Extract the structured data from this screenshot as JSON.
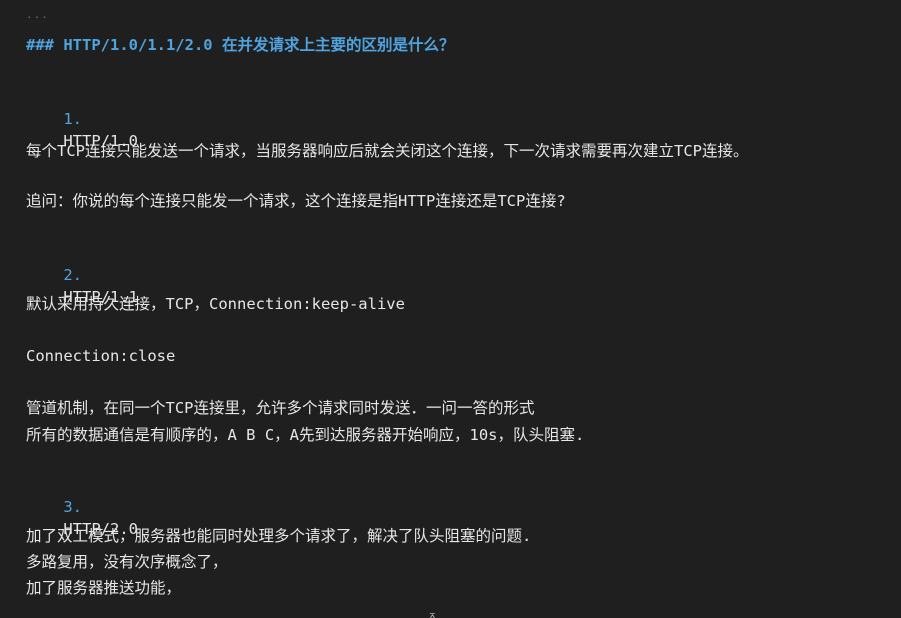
{
  "editor": {
    "fold_marker": "...",
    "heading": "### HTTP/1.0/1.1/2.0 在并发请求上主要的区别是什么？",
    "sections": [
      {
        "number": "1.",
        "title": "HTTP/1.0"
      },
      {
        "number": "2.",
        "title": "HTTP/1.1"
      },
      {
        "number": "3.",
        "title": "HTTP/2.0"
      }
    ],
    "paragraphs": {
      "p1": "每个TCP连接只能发送一个请求，当服务器响应后就会关闭这个连接，下一次请求需要再次建立TCP连接。",
      "p2": "追问：你说的每个连接只能发一个请求，这个连接是指HTTP连接还是TCP连接?",
      "p3": "默认采用持久连接，TCP，Connection:keep-alive",
      "p4": "Connection:close",
      "p5a": "管道机制，在同一个TCP连接里，允许多个请求同时发送．一问一答的形式",
      "p5b": "所有的数据通信是有顺序的，A B C，A先到达服务器开始响应，10s，队头阻塞.",
      "p6a": "加了双工模式，服务器也能同时处理多个请求了，解决了队头阻塞的问题.",
      "p6b": "多路复用，没有次序概念了，",
      "p6c": "加了服务器推送功能，"
    },
    "cursor_glyph": "⌅"
  }
}
